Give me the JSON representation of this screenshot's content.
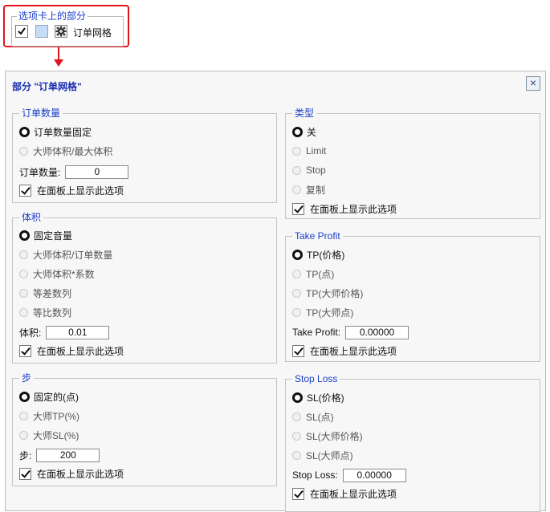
{
  "callout": {
    "legend": "选项卡上的部分",
    "item_label": "订单网格"
  },
  "panel": {
    "title": "部分 \"订单网格\"",
    "close_glyph": "×"
  },
  "show_on_panel": "在面板上显示此选项",
  "order_qty": {
    "legend": "订单数量",
    "options": [
      "订单数量固定",
      "大师体积/最大体积"
    ],
    "field_label": "订单数量:",
    "field_value": "0"
  },
  "volume": {
    "legend": "体积",
    "options": [
      "固定音量",
      "大师体积/订单数量",
      "大师体积*系数",
      "等差数列",
      "等比数列"
    ],
    "field_label": "体积:",
    "field_value": "0.01"
  },
  "step": {
    "legend": "步",
    "options": [
      "固定的(点)",
      "大师TP(%)",
      "大师SL(%)"
    ],
    "field_label": "步:",
    "field_value": "200"
  },
  "type": {
    "legend": "类型",
    "options": [
      "关",
      "Limit",
      "Stop",
      "复制"
    ]
  },
  "take_profit": {
    "legend": "Take Profit",
    "options": [
      "TP(价格)",
      "TP(点)",
      "TP(大师价格)",
      "TP(大师点)"
    ],
    "field_label": "Take Profit:",
    "field_value": "0.00000"
  },
  "stop_loss": {
    "legend": "Stop Loss",
    "options": [
      "SL(价格)",
      "SL(点)",
      "SL(大师价格)",
      "SL(大师点)"
    ],
    "field_label": "Stop Loss:",
    "field_value": "0.00000"
  },
  "icons": {
    "checkbox": "check-icon",
    "color": "color-swatch-icon",
    "settings": "gear-icon",
    "close": "close-icon"
  },
  "colors": {
    "accent_red": "#e0141b",
    "legend_blue": "#1a3fc7",
    "swatch": "#c5dcf7"
  }
}
